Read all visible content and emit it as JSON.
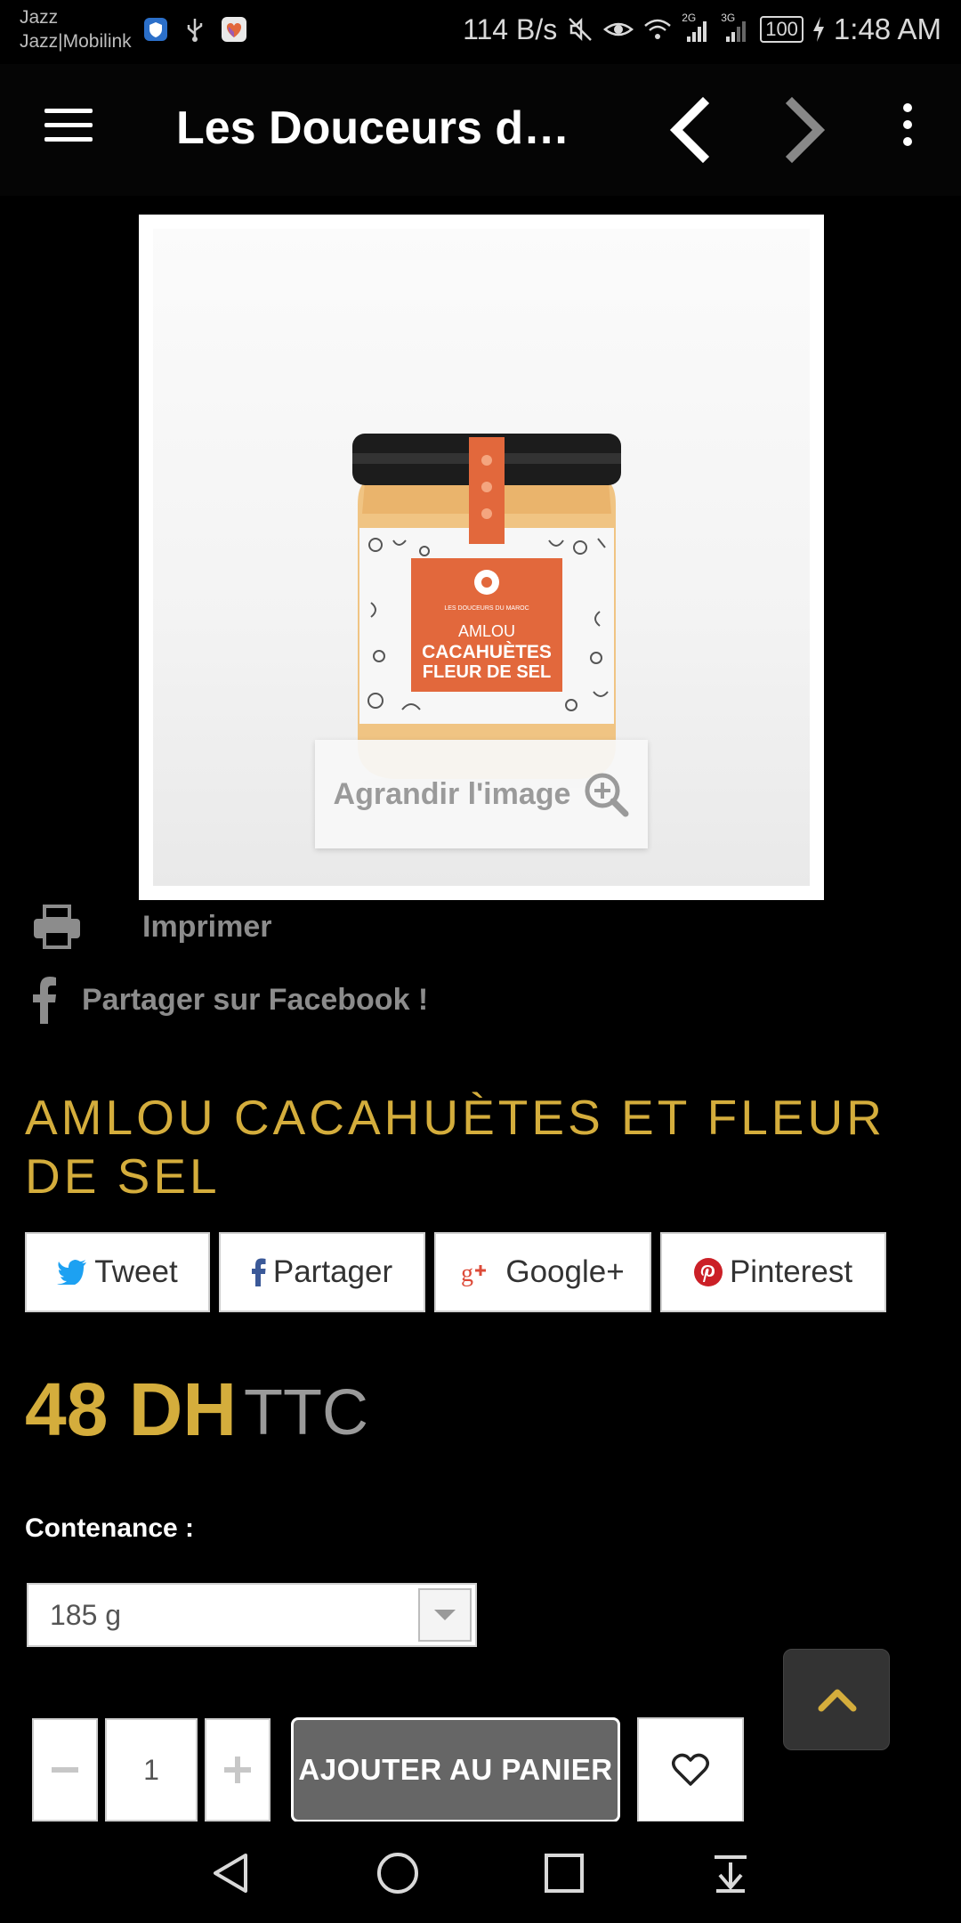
{
  "status_bar": {
    "carrier_line1": "Jazz",
    "carrier_line2": "Jazz|Mobilink",
    "net_rate": "114 B/s",
    "net_2g": "2G",
    "net_3g": "3G",
    "battery": "100",
    "time": "1:48 AM"
  },
  "app_bar": {
    "title": "Les Douceurs du Maroc"
  },
  "product_image": {
    "zoom_label": "Agrandir l'image",
    "jar_brand": "LES DOUCEURS DU MAROC",
    "jar_label_line1": "AMLOU",
    "jar_label_line2": "CACAHUÈTES",
    "jar_label_line3": "FLEUR DE SEL"
  },
  "actions": {
    "print_label": "Imprimer",
    "facebook_label": "Partager sur Facebook !"
  },
  "product": {
    "title": "AMLOU CACAHUÈTES ET FLEUR DE SEL",
    "price": "48 DH",
    "tax_label": "TTC"
  },
  "share": {
    "tweet": "Tweet",
    "facebook": "Partager",
    "google": "Google+",
    "pinterest": "Pinterest"
  },
  "variant": {
    "label": "Contenance :",
    "selected": "185 g"
  },
  "cart": {
    "quantity": "1",
    "add_label": "AJOUTER AU PANIER"
  },
  "colors": {
    "accent_gold": "#d4ad3c",
    "background": "#000000",
    "jar_label_orange": "#e2683c",
    "twitter_blue": "#1da1f2",
    "facebook_blue": "#3b5998",
    "google_red": "#dd4b39",
    "pinterest_red": "#cb2027"
  }
}
